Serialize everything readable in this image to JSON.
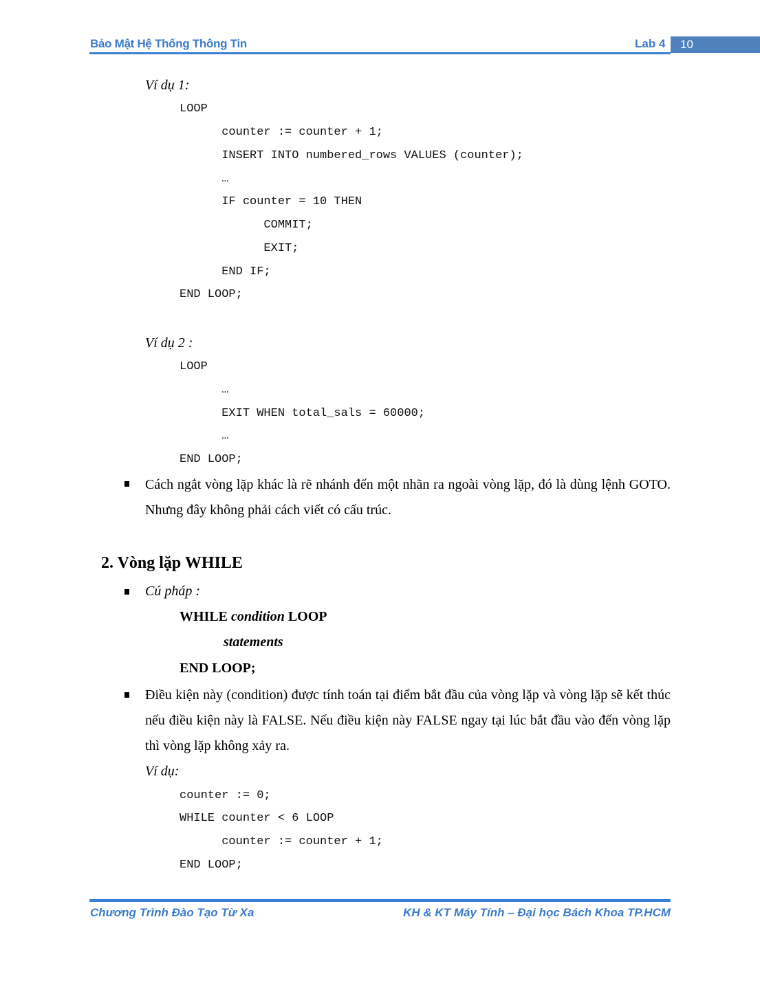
{
  "header": {
    "title": "Bảo Mật Hệ Thống Thông Tin",
    "lab": "Lab 4",
    "page_number": "10"
  },
  "example1": {
    "label": "Ví dụ 1:",
    "code": [
      "LOOP",
      "      counter := counter + 1;",
      "      INSERT INTO numbered_rows VALUES (counter);",
      "      …",
      "      IF counter = 10 THEN",
      "            COMMIT;",
      "            EXIT;",
      "      END IF;",
      "END LOOP;"
    ]
  },
  "example2": {
    "label": "Ví dụ 2 :",
    "code": [
      "LOOP",
      "      …",
      "      EXIT WHEN total_sals = 60000;",
      "      …",
      "END LOOP;"
    ]
  },
  "bullet_goto": "Cách ngắt vòng lặp khác là rẽ nhánh đến một nhãn ra ngoài vòng lặp, đó là dùng lệnh GOTO. Nhưng đây không phải cách viết có cấu trúc.",
  "section2": {
    "heading": "2.  Vòng lặp WHILE",
    "syntax_label": "Cú pháp :",
    "syntax": {
      "line1_kw1": "WHILE",
      "line1_var": "condition",
      "line1_kw2": "LOOP",
      "line2": "statements",
      "line3": "END LOOP;"
    },
    "description": "Điều kiện này (condition) được tính toán tại điểm bắt đầu của vòng lặp và vòng lặp sẽ kết thúc nếu điều kiện này là FALSE. Nếu điều kiện này FALSE ngay tại lúc bắt đầu vào đến vòng lặp thì vòng lặp không xảy ra.",
    "example_label": "Ví dụ:",
    "example_code": [
      "counter := 0;",
      "WHILE counter < 6 LOOP",
      "      counter := counter + 1;",
      "END LOOP;"
    ]
  },
  "footer": {
    "left": "Chương Trình Đào Tạo Từ Xa",
    "right": "KH & KT Máy Tính – Đại học Bách Khoa TP.HCM"
  },
  "colors": {
    "accent": "#3d7cc9",
    "page_box": "#4f81bd"
  }
}
